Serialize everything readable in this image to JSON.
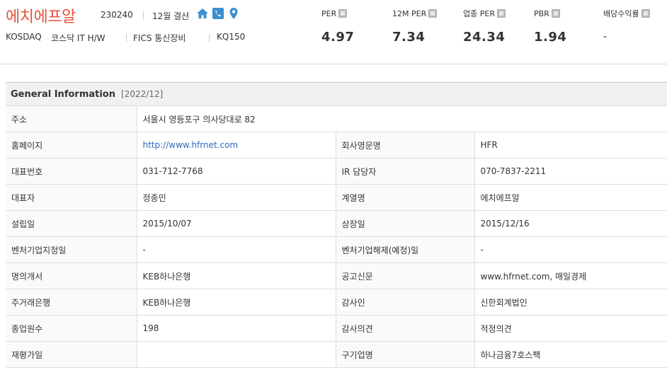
{
  "header": {
    "company_name": "에치에프알",
    "stock_code": "230240",
    "fiscal": "12월 결산",
    "market": "KOSDAQ",
    "sector": "코스닥 IT H/W",
    "fics": "FICS 통신장비",
    "index": "KQ150",
    "icon_colors": {
      "home": "#3a8fd0",
      "phone": "#3a8fd0",
      "location": "#3a8fd0"
    }
  },
  "metrics": [
    {
      "label": "PER",
      "value": "4.97"
    },
    {
      "label": "12M PER",
      "value": "7.34"
    },
    {
      "label": "업종 PER",
      "value": "24.34"
    },
    {
      "label": "PBR",
      "value": "1.94"
    },
    {
      "label": "배당수익률",
      "value": "-"
    }
  ],
  "general": {
    "title": "General Information",
    "date": "[2022/12]",
    "address_label": "주소",
    "address_value": "서울시 영등포구 의사당대로 82",
    "rows": [
      {
        "l1": "홈페이지",
        "v1": "http://www.hfrnet.com",
        "l2": "회사영문명",
        "v2": "HFR"
      },
      {
        "l1": "대표번호",
        "v1": "031-712-7768",
        "l2": "IR 담당자",
        "v2": "070-7837-2211"
      },
      {
        "l1": "대표자",
        "v1": "정종민",
        "l2": "계열명",
        "v2": "에치에프알"
      },
      {
        "l1": "설립일",
        "v1": "2015/10/07",
        "l2": "상장일",
        "v2": "2015/12/16"
      },
      {
        "l1": "벤처기업지정일",
        "v1": "-",
        "l2": "벤처기업해제(예정)일",
        "v2": "-"
      },
      {
        "l1": "명의개서",
        "v1": "KEB하나은행",
        "l2": "공고신문",
        "v2": "www.hfrnet.com,  매일경제"
      },
      {
        "l1": "주거래은행",
        "v1": "KEB하나은행",
        "l2": "감사인",
        "v2": "신한회계법인"
      },
      {
        "l1": "종업원수",
        "v1": "198",
        "l2": "감사의견",
        "v2": "적정의견"
      },
      {
        "l1": "재평가일",
        "v1": "",
        "l2": "구기업명",
        "v2": "하나금융7호스팩"
      }
    ]
  }
}
